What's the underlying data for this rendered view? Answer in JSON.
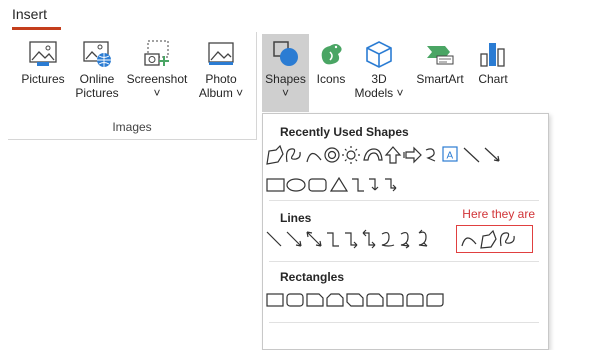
{
  "tab": {
    "label": "Insert"
  },
  "ribbon": {
    "images_group": {
      "label": "Images",
      "buttons": [
        {
          "label": "Pictures",
          "icon": "pictures-icon"
        },
        {
          "label": "Online\nPictures",
          "icon": "online-pictures-icon"
        },
        {
          "label": "Screenshot\n˅",
          "icon": "screenshot-icon"
        },
        {
          "label": "Photo\nAlbum ˅",
          "icon": "photo-album-icon"
        }
      ]
    },
    "illustrations": [
      {
        "label": "Shapes\n˅",
        "icon": "shapes-icon"
      },
      {
        "label": "Icons",
        "icon": "icons-icon"
      },
      {
        "label": "3D\nModels ˅",
        "icon": "3d-models-icon"
      },
      {
        "label": "SmartArt",
        "icon": "smartart-icon"
      },
      {
        "label": "Chart",
        "icon": "chart-icon"
      }
    ]
  },
  "dropdown": {
    "sections": [
      {
        "title": "Recently Used Shapes"
      },
      {
        "title": "Lines"
      },
      {
        "title": "Rectangles"
      }
    ],
    "callout": "Here they are"
  },
  "colors": {
    "accent": "#c43e1c",
    "callout": "#d13438",
    "selected": "#cfcfcf",
    "icon_blue": "#2b7cd3",
    "icon_green": "#4aa564"
  }
}
